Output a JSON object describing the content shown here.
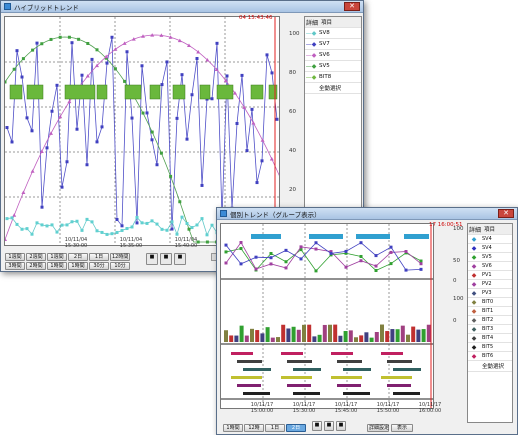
{
  "win1": {
    "title": "ハイブリッドトレンド",
    "timestamp": "04 15:43:46",
    "yaxis": [
      "100",
      "80",
      "60",
      "40",
      "20"
    ],
    "header": {
      "col1": "詳細",
      "col2": "項目"
    },
    "items": [
      {
        "label": "SV8",
        "color": "#60c8c8"
      },
      {
        "label": "SV7",
        "color": "#4040c0"
      },
      {
        "label": "SV6",
        "color": "#c060c0"
      },
      {
        "label": "SV5",
        "color": "#40a040"
      },
      {
        "label": "BIT8",
        "color": "#70b840"
      }
    ],
    "all_select": "全動選択",
    "times": [
      {
        "d": "10/11/04",
        "t": "15:30:00"
      },
      {
        "d": "10/11/04",
        "t": "15:35:00"
      },
      {
        "d": "10/11/04",
        "t": "15:40:00"
      }
    ],
    "buttons_row1": [
      "1週間",
      "2週間",
      "1週間",
      "2日",
      "1日",
      "12時間"
    ],
    "buttons_row2": [
      "3時間",
      "2時間",
      "1時間",
      "1時間",
      "30分",
      "10分"
    ]
  },
  "win2": {
    "title": "個別トレンド（グループ表示）",
    "timestamp": "17 16:00:51",
    "header": {
      "col1": "詳細",
      "col2": "項目"
    },
    "items": [
      {
        "label": "SV4",
        "color": "#30a0d0"
      },
      {
        "label": "SV4",
        "color": "#3030c0"
      },
      {
        "label": "SV5",
        "color": "#30a030"
      },
      {
        "label": "SV6",
        "color": "#a040a0"
      },
      {
        "label": "PV1",
        "color": "#c03030"
      },
      {
        "label": "PV2",
        "color": "#a040a0"
      },
      {
        "label": "PV3",
        "color": "#405080"
      },
      {
        "label": "BIT0",
        "color": "#808040"
      },
      {
        "label": "BIT1",
        "color": "#c06040"
      },
      {
        "label": "BIT2",
        "color": "#606060"
      },
      {
        "label": "BIT3",
        "color": "#406060"
      },
      {
        "label": "BIT4",
        "color": "#404040"
      },
      {
        "label": "BIT5",
        "color": "#202020"
      },
      {
        "label": "BIT6",
        "color": "#c02060"
      }
    ],
    "all_select": "全動選択",
    "yaxis": [
      "100",
      "50",
      "0"
    ],
    "times": [
      {
        "d": "10/11/17",
        "t": "15:00:00"
      },
      {
        "d": "10/11/17",
        "t": "15:30:00"
      },
      {
        "d": "10/11/17",
        "t": "15:45:00"
      },
      {
        "d": "10/11/17",
        "t": "15:50:00"
      },
      {
        "d": "10/11/17",
        "t": "16:00:00"
      }
    ],
    "bottom_buttons": [
      "1時間",
      "12時",
      "1日",
      "2日"
    ],
    "nav_buttons": [
      "詳細設定",
      "表示"
    ]
  }
}
